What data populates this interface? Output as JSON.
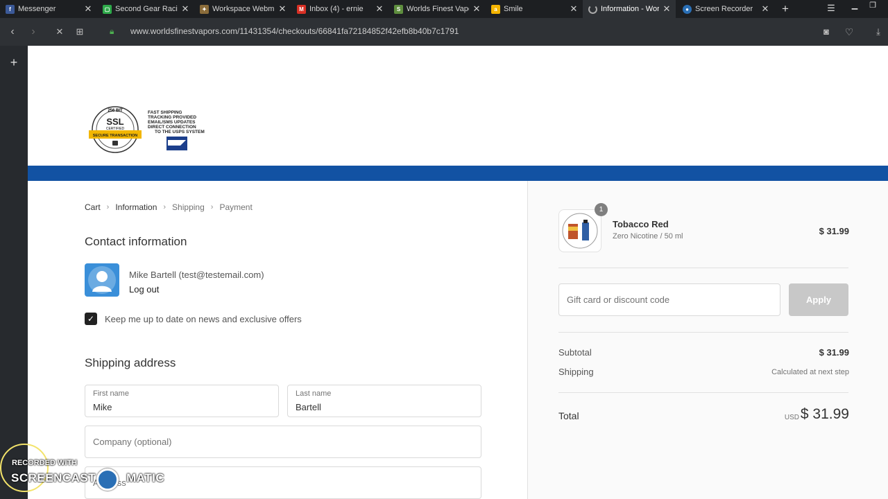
{
  "browser": {
    "tabs": [
      {
        "title": "Messenger",
        "favicon": "facebook-icon",
        "color": "#3b5998"
      },
      {
        "title": "Second Gear Racing",
        "favicon": "green-app-icon",
        "color": "#2eaa4a"
      },
      {
        "title": "Workspace Webmail",
        "favicon": "workspace-icon",
        "color": "#8b6c3a"
      },
      {
        "title": "Inbox (4) - ernie",
        "favicon": "gmail-icon",
        "color": "#d93025"
      },
      {
        "title": "Worlds Finest Vapors",
        "favicon": "shopify-icon",
        "color": "#5e8e3e"
      },
      {
        "title": "Smile",
        "favicon": "smile-icon",
        "color": "#f4b400"
      },
      {
        "title": "Information - Worlds",
        "favicon": "loading-spinner-icon",
        "color": "#aaaaaa"
      },
      {
        "title": "Screen Recorder",
        "favicon": "screen-recorder-icon",
        "color": "#2a6fb5"
      }
    ],
    "url": "www.worldsfinestvapors.com/11431354/checkouts/66841fa72184852f42efb8b40b7c1791"
  },
  "header": {
    "badge_ssl_text": "SSL",
    "badge_ssl_top": "256 BIT",
    "badge_ssl_mid": "CERTIFIED",
    "badge_ssl_ribbon": "SECURE TRANSACTION",
    "shipping_badge_lines": [
      "FAST SHIPPING",
      "TRACKING PROVIDED",
      "EMAIL/SMS UPDATES",
      "DIRECT CONNECTION",
      "TO THE USPS SYSTEM"
    ]
  },
  "breadcrumb": {
    "cart": "Cart",
    "information": "Information",
    "shipping": "Shipping",
    "payment": "Payment"
  },
  "contact": {
    "heading": "Contact information",
    "user": "Mike Bartell (test@testemail.com)",
    "logout": "Log out",
    "newsletter_label": "Keep me up to date on news and exclusive offers",
    "newsletter_checked": true
  },
  "shipping_address": {
    "heading": "Shipping address",
    "first_name_label": "First name",
    "first_name_value": "Mike",
    "last_name_label": "Last name",
    "last_name_value": "Bartell",
    "company_placeholder": "Company (optional)",
    "address_placeholder": "Address"
  },
  "order": {
    "item_name": "Tobacco Red",
    "item_variant": "Zero Nicotine / 50 ml",
    "item_price": "$ 31.99",
    "item_qty": "1",
    "discount_placeholder": "Gift card or discount code",
    "apply_label": "Apply",
    "subtotal_label": "Subtotal",
    "subtotal_value": "$ 31.99",
    "shipping_label": "Shipping",
    "shipping_value": "Calculated at next step",
    "total_label": "Total",
    "currency": "USD",
    "total_value": "$ 31.99"
  },
  "watermark": {
    "line1": "RECORDED WITH",
    "line2": "SCREENCAST",
    "line3": "MATIC"
  }
}
